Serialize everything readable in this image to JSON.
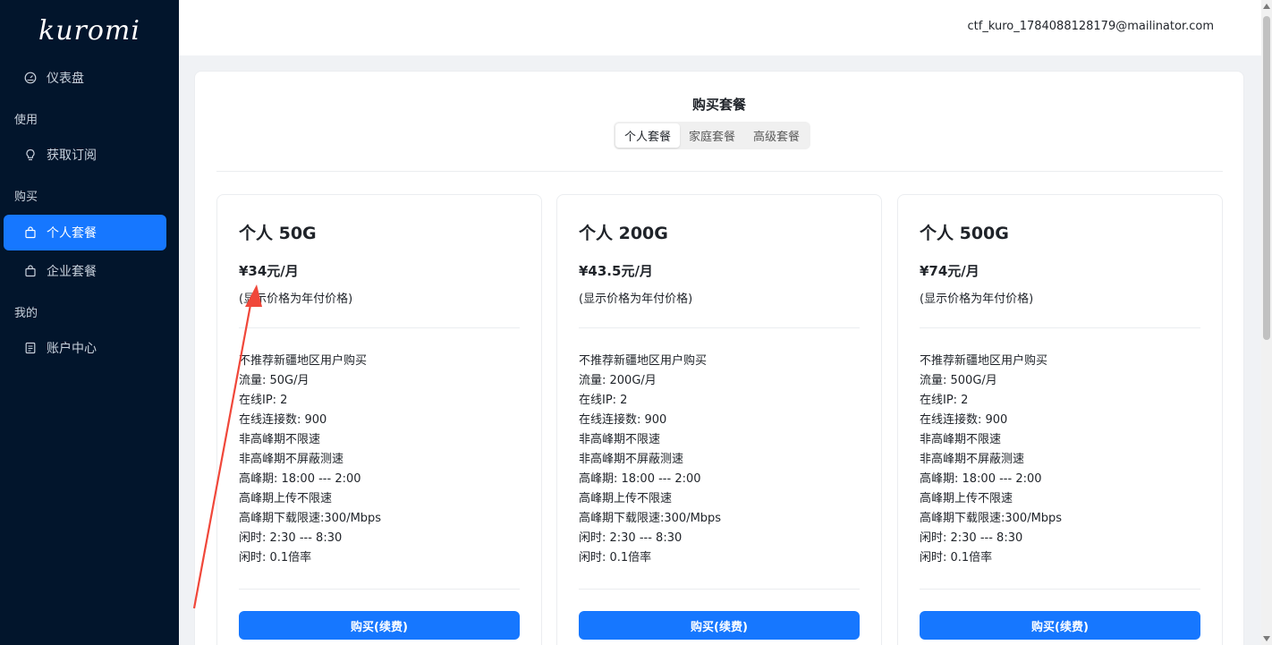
{
  "app": {
    "logo_text": "kuromi"
  },
  "sidebar": {
    "dashboard": {
      "label": "仪表盘",
      "icon": "dashboard-icon"
    },
    "group_use": "使用",
    "subscribe": {
      "label": "获取订阅",
      "icon": "bulb-icon"
    },
    "group_buy": "购买",
    "personal_plan": {
      "label": "个人套餐",
      "icon": "bag-icon",
      "active": true
    },
    "enterprise_plan": {
      "label": "企业套餐",
      "icon": "bag-icon"
    },
    "group_mine": "我的",
    "account": {
      "label": "账户中心",
      "icon": "account-icon"
    }
  },
  "header": {
    "user_email": "ctf_kuro_1784088128179@mailinator.com"
  },
  "page": {
    "title": "购买套餐",
    "tabs": [
      {
        "label": "个人套餐",
        "active": true
      },
      {
        "label": "家庭套餐",
        "active": false
      },
      {
        "label": "高级套餐",
        "active": false
      }
    ]
  },
  "plans": [
    {
      "name": "个人 50G",
      "price": "¥34元/月",
      "note": "(显示价格为年付价格)",
      "features": [
        "不推荐新疆地区用户购买",
        "流量: 50G/月",
        "在线IP: 2",
        "在线连接数: 900",
        "非高峰期不限速",
        "非高峰期不屏蔽测速",
        "高峰期: 18:00 --- 2:00",
        "高峰期上传不限速",
        "高峰期下载限速:300/Mbps",
        "闲时: 2:30 --- 8:30",
        "闲时: 0.1倍率"
      ],
      "button": "购买(续费)"
    },
    {
      "name": "个人 200G",
      "price": "¥43.5元/月",
      "note": "(显示价格为年付价格)",
      "features": [
        "不推荐新疆地区用户购买",
        "流量: 200G/月",
        "在线IP: 2",
        "在线连接数: 900",
        "非高峰期不限速",
        "非高峰期不屏蔽测速",
        "高峰期: 18:00 --- 2:00",
        "高峰期上传不限速",
        "高峰期下载限速:300/Mbps",
        "闲时: 2:30 --- 8:30",
        "闲时: 0.1倍率"
      ],
      "button": "购买(续费)"
    },
    {
      "name": "个人 500G",
      "price": "¥74元/月",
      "note": "(显示价格为年付价格)",
      "features": [
        "不推荐新疆地区用户购买",
        "流量: 500G/月",
        "在线IP: 2",
        "在线连接数: 900",
        "非高峰期不限速",
        "非高峰期不屏蔽测速",
        "高峰期: 18:00 --- 2:00",
        "高峰期上传不限速",
        "高峰期下载限速:300/Mbps",
        "闲时: 2:30 --- 8:30",
        "闲时: 0.1倍率"
      ],
      "button": "购买(续费)"
    }
  ],
  "colors": {
    "sidebar_bg": "#02152c",
    "accent": "#1677ff",
    "annotation": "#f0473a"
  }
}
